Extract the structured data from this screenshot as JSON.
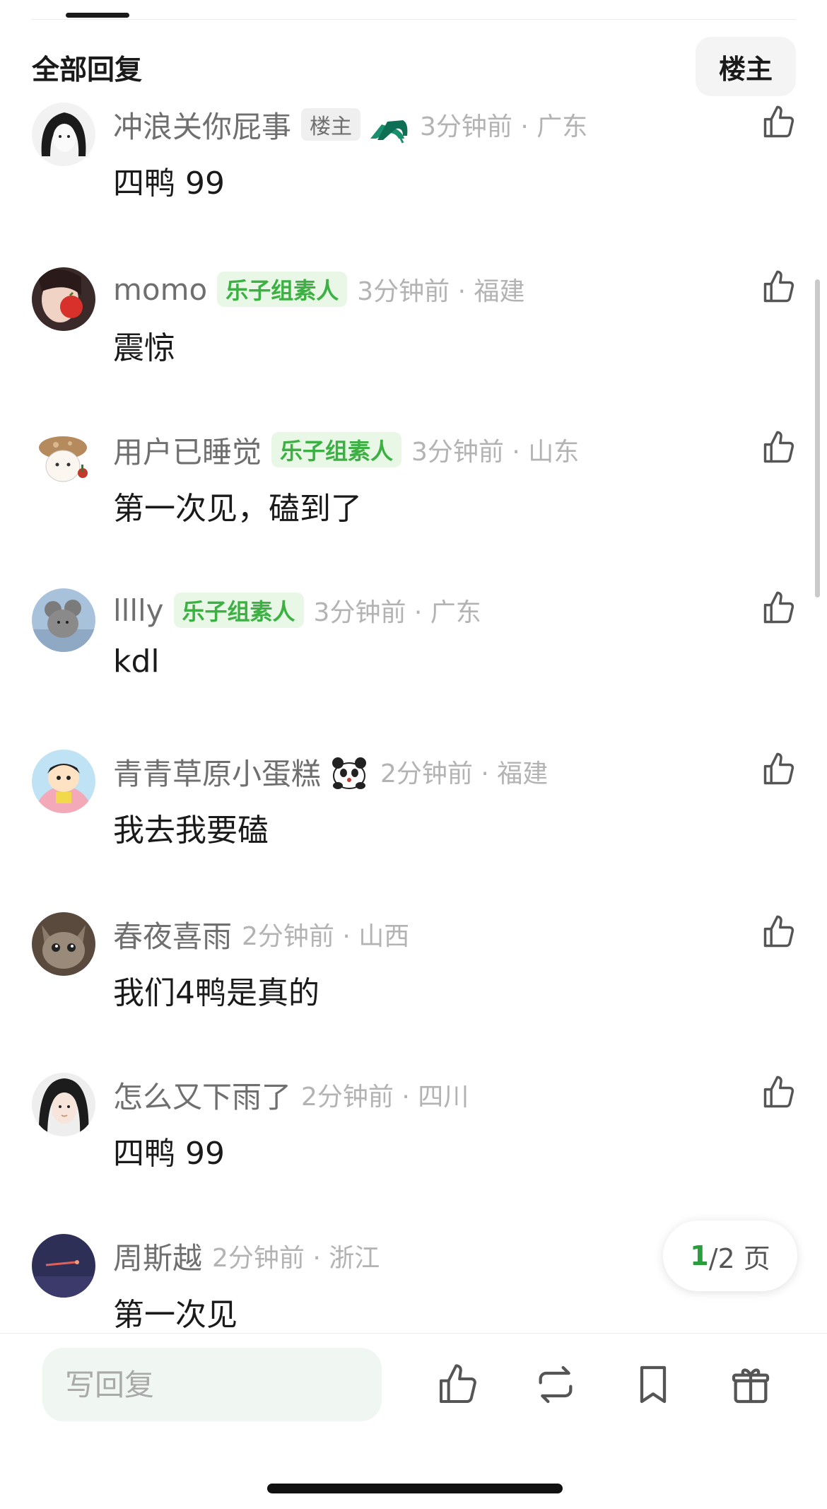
{
  "header": {
    "title": "全部回复",
    "op_filter_label": "楼主"
  },
  "comments": [
    {
      "username": "冲浪关你屁事",
      "badge_op": "楼主",
      "sticker": "high-heels-icon",
      "time": "3分钟前 · 广东",
      "text": "四鸭 99",
      "avatar": "avatar-bw-girl"
    },
    {
      "username": "momo",
      "group_badge": "乐子组素人",
      "time": "3分钟前 · 福建",
      "text": "震惊",
      "avatar": "avatar-girl-apple"
    },
    {
      "username": "用户已睡觉",
      "group_badge": "乐子组素人",
      "time": "3分钟前 · 山东",
      "text": "第一次见，磕到了",
      "avatar": "avatar-mushroom-cat"
    },
    {
      "username": "lllly",
      "group_badge": "乐子组素人",
      "time": "3分钟前 · 广东",
      "text": "kdl",
      "avatar": "avatar-plush-toy"
    },
    {
      "username": "青青草原小蛋糕",
      "sticker": "panda-icon",
      "time": "2分钟前 · 福建",
      "text": "我去我要磕",
      "avatar": "avatar-cartoon-boy"
    },
    {
      "username": "春夜喜雨",
      "time": "2分钟前 · 山西",
      "text": "我们4鸭是真的",
      "avatar": "avatar-kitten"
    },
    {
      "username": "怎么又下雨了",
      "time": "2分钟前 · 四川",
      "text": "四鸭 99",
      "avatar": "avatar-girl-portrait"
    },
    {
      "username": "周斯越",
      "time": "2分钟前 · 浙江",
      "text": "第一次见",
      "avatar": "avatar-night-sky"
    }
  ],
  "pagination": {
    "current": "1",
    "total_label": "/2 页"
  },
  "bottom_bar": {
    "reply_placeholder": "写回复",
    "icons": [
      "thumb-up-icon",
      "repost-icon",
      "bookmark-icon",
      "gift-icon"
    ]
  },
  "colors": {
    "accent_green": "#3cb043",
    "badge_green_bg": "#e9f8e6",
    "meta_gray": "#b3b3b3",
    "username_gray": "#6f6f6f"
  }
}
